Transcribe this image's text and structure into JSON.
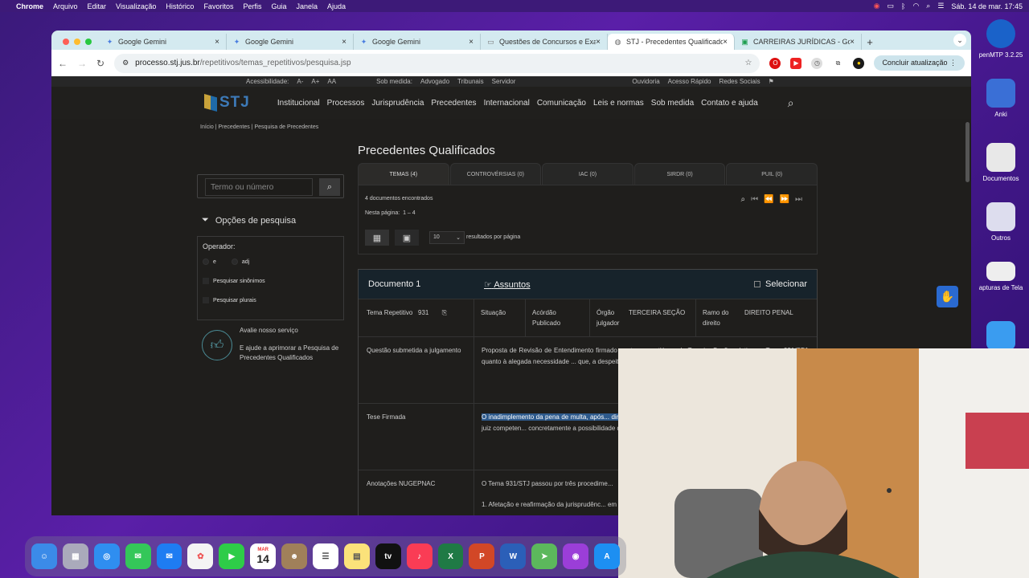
{
  "menubar": {
    "app": "Chrome",
    "items": [
      "Arquivo",
      "Editar",
      "Visualização",
      "Histórico",
      "Favoritos",
      "Perfis",
      "Guia",
      "Janela",
      "Ajuda"
    ],
    "clock": "Sáb. 14 de mar.  17:45"
  },
  "browser": {
    "tabs": [
      {
        "title": "Google Gemini",
        "icon": "gemini-icon"
      },
      {
        "title": "Google Gemini",
        "icon": "gemini-icon"
      },
      {
        "title": "Google Gemini",
        "icon": "gemini-icon"
      },
      {
        "title": "Questões de Concursos e Exa",
        "icon": "qconcursos-icon"
      },
      {
        "title": "STJ - Precedentes Qualificado",
        "icon": "globe-icon"
      },
      {
        "title": "CARREIRAS JURÍDICAS - Goo",
        "icon": "sheets-icon"
      }
    ],
    "url_host": "processo.stj.jus.br",
    "url_path": "/repetitivos/temas_repetitivos/pesquisa.jsp",
    "update_button": "Concluir atualização"
  },
  "site": {
    "utility": [
      "Acessibilidade:",
      "A-",
      "A+",
      "AA",
      "Sob medida:",
      "Advogado",
      "Tribunais",
      "Servidor",
      "Ouvidoria",
      "Acesso Rápido",
      "Redes Sociais"
    ],
    "logo": "STJ",
    "nav": [
      "Institucional",
      "Processos",
      "Jurisprudência",
      "Precedentes",
      "Internacional",
      "Comunicação",
      "Leis e normas",
      "Sob medida",
      "Contato e ajuda"
    ],
    "breadcrumb": [
      "Início",
      "Precedentes",
      "Pesquisa de Precedentes"
    ],
    "title": "Precedentes Qualificados",
    "search_placeholder": "Termo ou número",
    "options_title": "Opções de pesquisa",
    "operator_label": "Operador:",
    "operator_options": [
      "e",
      "adj"
    ],
    "checkbox_synonyms": "Pesquisar sinônimos",
    "checkbox_plurals": "Pesquisar plurais",
    "rate_title": "Avalie nosso serviço",
    "rate_text": "E ajude a aprimorar a Pesquisa de Precedentes Qualificados",
    "result_tabs": [
      "TEMAS (4)",
      "CONTROVÉRSIAS (0)",
      "IAC (0)",
      "SIRDR (0)",
      "PUIL (0)"
    ],
    "found": "4 documentos encontrados",
    "page_label": "Nesta página:",
    "page_range": "1 – 4",
    "per_page_value": "10",
    "per_page_label": "resultados por página",
    "document": {
      "title": "Documento 1",
      "subjects": "Assuntos",
      "select": "Selecionar",
      "tema_label": "Tema Repetitivo",
      "tema_num": "931",
      "situacao_label": "Situação",
      "situacao": "Acórdão Publicado",
      "orgao_label": "Órgão julgador",
      "orgao": "TERCEIRA SEÇÃO",
      "ramo_label": "Ramo do direito",
      "ramo": "DIREITO PENAL",
      "questao_label": "Questão submetida a julgamento",
      "questao": "Proposta de Revisão de Entendimento firmado em tese repetitiva pela Terceira Seção relativa ao Tema 931/STJ, quanto à alegada necessidade ... que, a despeito do inadimplemento da p... extinção de sua punibilidade.",
      "tese_label": "Tese Firmada",
      "tese_highlight": "O inadimplemento da pena de multa, após... direitos, não obsta a extinção da punibilid...",
      "tese_rest": "diversamente entender o juiz competen... concretamente a possibilidade de pagamen...",
      "anot_label": "Anotações NUGEPNAC",
      "anot": "O Tema 931/STJ passou por três procedime...",
      "anot2": "1. Afetação e reafirmação da jurisprudênc... em 20/10/2020, a Terceira Seção revisou ..."
    }
  },
  "desktop": [
    {
      "label": "penMTP 3.2.25"
    },
    {
      "label": "Anki"
    },
    {
      "label": "Documentos"
    },
    {
      "label": "Outros"
    },
    {
      "label": "apturas de Tela"
    }
  ],
  "dock": {
    "calendar_month": "MAR",
    "calendar_day": "14",
    "tv_label": "tv"
  }
}
